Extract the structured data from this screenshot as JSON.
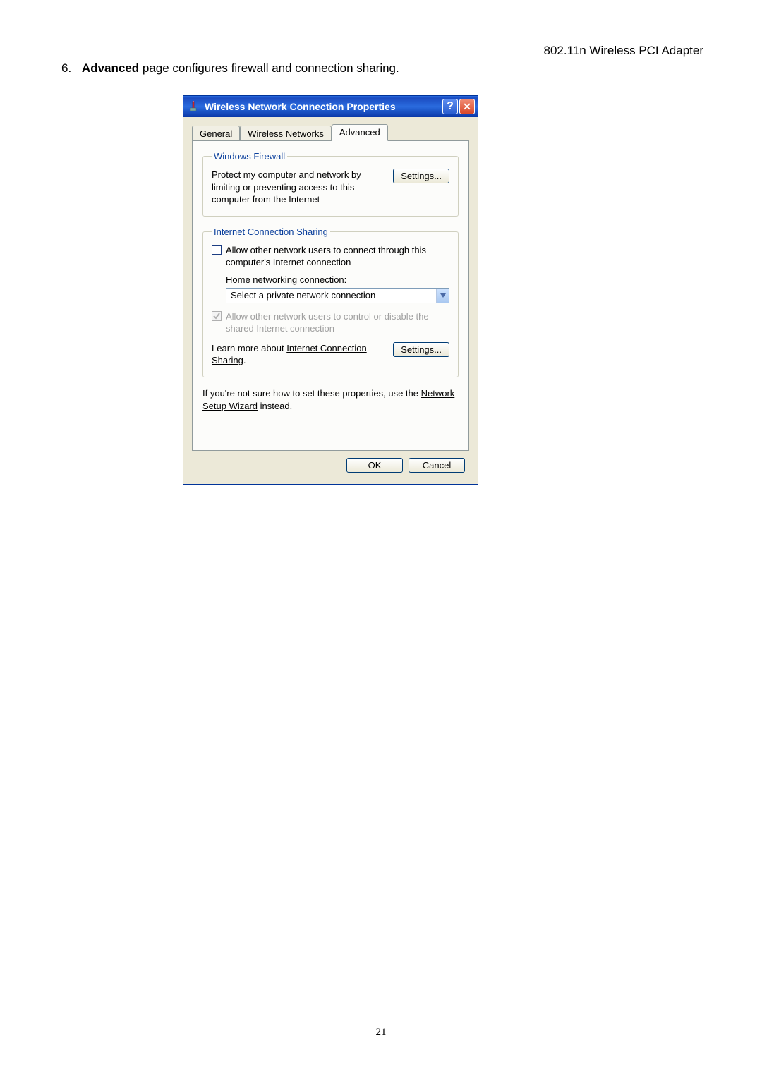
{
  "page": {
    "header": "802.11n Wireless PCI Adapter",
    "intro_number": "6.",
    "intro_bold": "Advanced",
    "intro_rest": " page configures firewall and connection sharing.",
    "page_number": "21"
  },
  "dialog": {
    "title": "Wireless Network Connection Properties",
    "help_glyph": "?",
    "close_glyph": "✕",
    "tabs": {
      "general": "General",
      "wireless": "Wireless Networks",
      "advanced": "Advanced"
    },
    "firewall": {
      "legend": "Windows Firewall",
      "text": "Protect my computer and network by limiting or preventing access to this computer from the Internet",
      "settings_btn": "Settings..."
    },
    "ics": {
      "legend": "Internet Connection Sharing",
      "allow_connect": "Allow other network users to connect through this computer's Internet connection",
      "home_label": "Home networking connection:",
      "dropdown_value": "Select a private network connection",
      "allow_control": "Allow other network users to control or disable the shared Internet connection",
      "learn_prefix": "Learn more about ",
      "learn_link": "Internet Connection Sharing",
      "learn_suffix": ".",
      "settings_btn": "Settings..."
    },
    "help_text_prefix": "If you're not sure how to set these properties, use the ",
    "help_text_link": "Network Setup Wizard",
    "help_text_suffix": " instead.",
    "ok_btn": "OK",
    "cancel_btn": "Cancel"
  }
}
